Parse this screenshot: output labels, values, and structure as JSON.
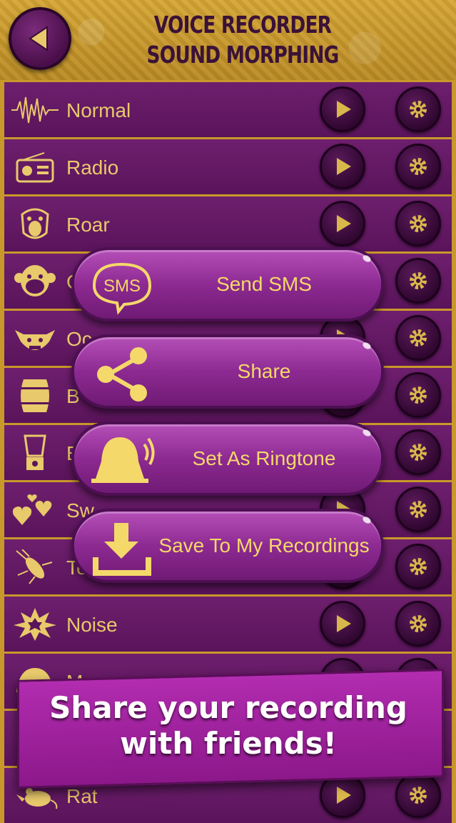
{
  "header": {
    "title_line1": "Voice Recorder",
    "title_line2": "Sound Morphing"
  },
  "effects": [
    {
      "label": "Normal",
      "icon": "waveform-icon"
    },
    {
      "label": "Radio",
      "icon": "radio-icon"
    },
    {
      "label": "Roar",
      "icon": "gorilla-roar-icon"
    },
    {
      "label": "C",
      "icon": "monkey-icon"
    },
    {
      "label": "Oc",
      "icon": "ogre-icon"
    },
    {
      "label": "B",
      "icon": "barrel-icon"
    },
    {
      "label": "E",
      "icon": "blender-icon"
    },
    {
      "label": "Sw",
      "icon": "hearts-icon"
    },
    {
      "label": "Te",
      "icon": "cockroach-icon"
    },
    {
      "label": "Noise",
      "icon": "explosion-icon"
    },
    {
      "label": "M",
      "icon": "monster-icon"
    },
    {
      "label": "",
      "icon": "helmet-icon"
    },
    {
      "label": "Rat",
      "icon": "rat-icon"
    }
  ],
  "share_menu": [
    {
      "label": "Send SMS",
      "icon": "sms-bubble-icon"
    },
    {
      "label": "Share",
      "icon": "share-icon"
    },
    {
      "label": "Set As Ringtone",
      "icon": "bell-icon"
    },
    {
      "label": "Save To My Recordings",
      "icon": "download-icon"
    }
  ],
  "sms_icon_text": "SMS",
  "banner": {
    "line1": "Share your recording",
    "line2": "with friends!"
  },
  "colors": {
    "gold": "#e8c96b",
    "purple_row": "#6e1f6e",
    "button_text": "#f4d86a",
    "banner": "#b22cb0"
  }
}
